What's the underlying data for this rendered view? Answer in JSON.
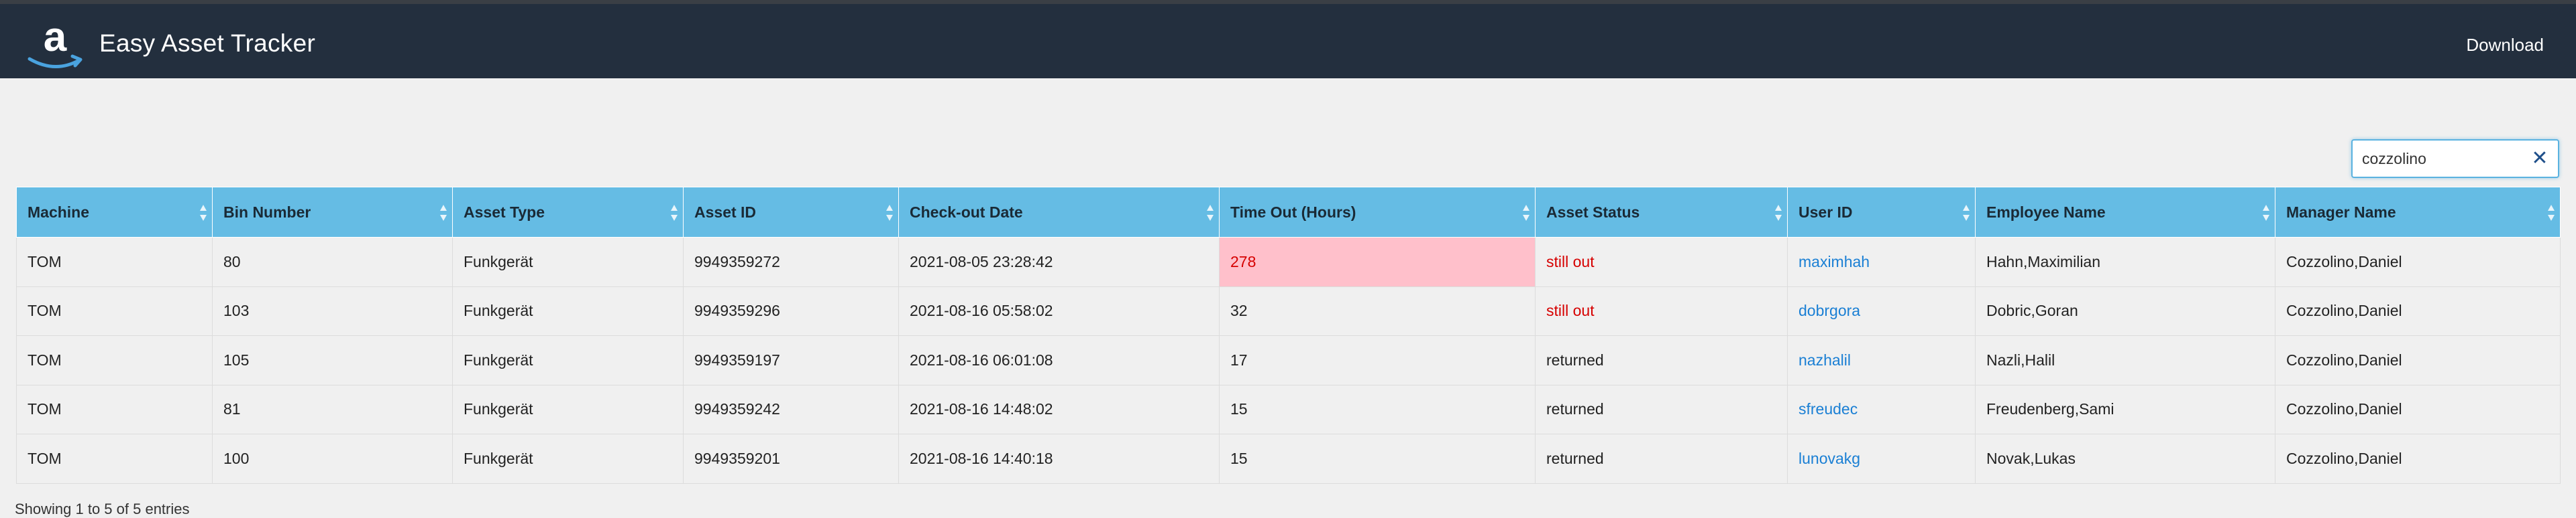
{
  "header": {
    "title": "Easy Asset Tracker",
    "download_label": "Download",
    "brand_logo": "amazon-logo",
    "logo_letter": "a",
    "colors": {
      "navbar": "#232f3e",
      "accent": "#ff9900",
      "header_row": "#65bce4"
    }
  },
  "search": {
    "value": "cozzolino",
    "clear_icon": "close-icon"
  },
  "table": {
    "columns": [
      "Machine",
      "Bin Number",
      "Asset Type",
      "Asset ID",
      "Check-out Date",
      "Time Out (Hours)",
      "Asset Status",
      "User ID",
      "Employee Name",
      "Manager Name"
    ],
    "rows": [
      [
        "TOM",
        "80",
        "Funkgerät",
        "9949359272",
        "2021-08-05 23:28:42",
        "278",
        "still out",
        "maximhah",
        "Hahn,Maximilian",
        "Cozzolino,Daniel"
      ],
      [
        "TOM",
        "103",
        "Funkgerät",
        "9949359296",
        "2021-08-16 05:58:02",
        "32",
        "still out",
        "dobrgora",
        "Dobric,Goran",
        "Cozzolino,Daniel"
      ],
      [
        "TOM",
        "105",
        "Funkgerät",
        "9949359197",
        "2021-08-16 06:01:08",
        "17",
        "returned",
        "nazhalil",
        "Nazli,Halil",
        "Cozzolino,Daniel"
      ],
      [
        "TOM",
        "81",
        "Funkgerät",
        "9949359242",
        "2021-08-16 14:48:02",
        "15",
        "returned",
        "sfreudec",
        "Freudenberg,Sami",
        "Cozzolino,Daniel"
      ],
      [
        "TOM",
        "100",
        "Funkgerät",
        "9949359201",
        "2021-08-16 14:40:18",
        "15",
        "returned",
        "lunovakg",
        "Novak,Lukas",
        "Cozzolino,Daniel"
      ]
    ]
  },
  "footer": {
    "info": "Showing 1 to 5 of 5 entries"
  }
}
